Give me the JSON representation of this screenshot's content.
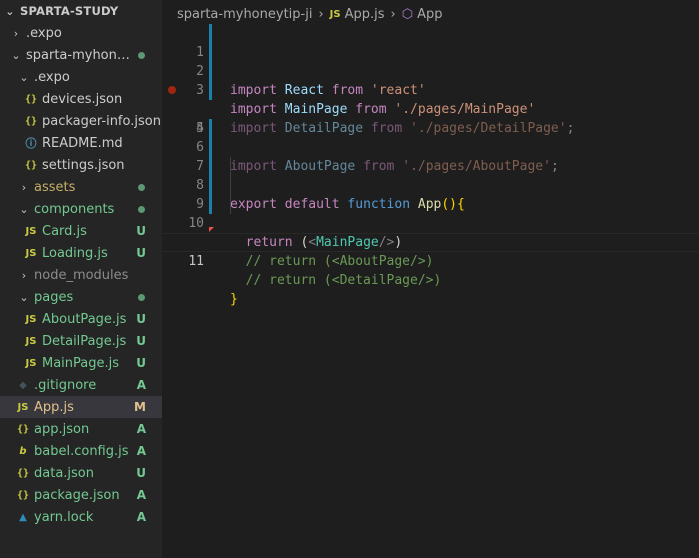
{
  "explorer": {
    "root": "SPARTA-STUDY",
    "items": [
      {
        "label": ".expo",
        "kind": "folder",
        "collapsed": true
      },
      {
        "label": "sparta-myhoney...",
        "kind": "folder",
        "collapsed": false
      },
      {
        "label": ".expo",
        "kind": "folder",
        "collapsed": false
      },
      {
        "label": "devices.json",
        "kind": "json"
      },
      {
        "label": "packager-info.json",
        "kind": "json"
      },
      {
        "label": "README.md",
        "kind": "info"
      },
      {
        "label": "settings.json",
        "kind": "json"
      },
      {
        "label": "assets",
        "kind": "folder",
        "collapsed": true
      },
      {
        "label": "components",
        "kind": "folder",
        "collapsed": false
      },
      {
        "label": "Card.js",
        "kind": "js",
        "badge": "U"
      },
      {
        "label": "Loading.js",
        "kind": "js",
        "badge": "U"
      },
      {
        "label": "node_modules",
        "kind": "folder",
        "collapsed": true
      },
      {
        "label": "pages",
        "kind": "folder",
        "collapsed": false
      },
      {
        "label": "AboutPage.js",
        "kind": "js",
        "badge": "U"
      },
      {
        "label": "DetailPage.js",
        "kind": "js",
        "badge": "U"
      },
      {
        "label": "MainPage.js",
        "kind": "js",
        "badge": "U"
      },
      {
        "label": ".gitignore",
        "kind": "git",
        "badge": "A"
      },
      {
        "label": "App.js",
        "kind": "js",
        "badge": "M"
      },
      {
        "label": "app.json",
        "kind": "json",
        "badge": "A"
      },
      {
        "label": "babel.config.js",
        "kind": "babel",
        "badge": "A"
      },
      {
        "label": "data.json",
        "kind": "json",
        "badge": "U"
      },
      {
        "label": "package.json",
        "kind": "json",
        "badge": "A"
      },
      {
        "label": "yarn.lock",
        "kind": "yarn",
        "badge": "A"
      }
    ]
  },
  "icons": {
    "js": "JS",
    "json": "{}",
    "info": "ⓘ",
    "git": "◆",
    "babel": "b",
    "yarn": "🧶"
  },
  "breadcrumb": {
    "folder": "sparta-myhoneytip-ji",
    "file": "App.js",
    "symbol": "App"
  },
  "editor": {
    "line_numbers": [
      "1",
      "2",
      "3",
      "4",
      "5",
      "6",
      "7",
      "8",
      "9",
      "10",
      "11"
    ],
    "code": {
      "l1": [
        "import",
        " ",
        "React",
        " ",
        "from",
        " ",
        "'react'"
      ],
      "l2": [
        "import",
        " ",
        "MainPage",
        " ",
        "from",
        " ",
        "'./pages/MainPage'"
      ],
      "l3": [
        "import",
        " ",
        "DetailPage",
        " ",
        "from",
        " ",
        "'./pages/DetailPage'",
        ";"
      ],
      "l4": [
        "import",
        " ",
        "AboutPage",
        " ",
        "from",
        " ",
        "'./pages/AboutPage'",
        ";"
      ],
      "l7": [
        "export",
        " ",
        "default",
        " ",
        "function",
        " ",
        "App",
        "(){"
      ],
      "l8": [
        "  ",
        "return",
        " (",
        "<",
        "MainPage",
        "/>",
        ")"
      ],
      "l9": [
        "  // return (<AboutPage/>)"
      ],
      "l10": [
        "  // return (<DetailPage/>)"
      ],
      "l11": [
        "}"
      ]
    }
  },
  "colors": {
    "background": "#1e1e1e",
    "sidebar": "#252526",
    "untracked": "#73c991",
    "modified": "#e2c08d"
  }
}
